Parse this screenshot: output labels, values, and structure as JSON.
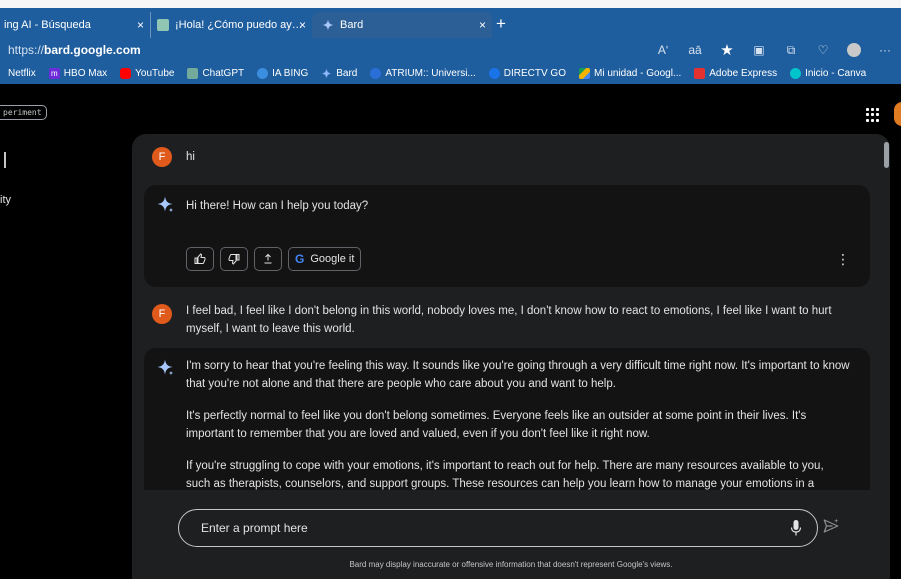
{
  "browser": {
    "tabs": [
      {
        "title": "ing AI - Búsqueda",
        "active": false
      },
      {
        "title": "¡Hola! ¿Cómo puedo ayudarte?",
        "active": false
      },
      {
        "title": "Bard",
        "active": true
      }
    ],
    "close_glyph": "×",
    "new_tab_glyph": "+",
    "url_scheme": "https://",
    "url_host": "bard.google.com",
    "address_icons": [
      "Aʹ",
      "aā",
      "★",
      "▣",
      "⧉",
      "♡",
      "···"
    ],
    "bookmarks": [
      {
        "label": "Netflix",
        "color": ""
      },
      {
        "label": "HBO Max",
        "color": "#6e2bd9",
        "glyph": "m"
      },
      {
        "label": "YouTube",
        "color": "#ff0000"
      },
      {
        "label": "ChatGPT",
        "color": "#74aa9c"
      },
      {
        "label": "IA BING",
        "color": "#3b8de0"
      },
      {
        "label": "Bard",
        "color": "#8ab4f8"
      },
      {
        "label": "ATRIUM:: Universi...",
        "color": "#2a6fd8"
      },
      {
        "label": "DIRECTV GO",
        "color": "#1a73e8"
      },
      {
        "label": "Mi unidad - Googl...",
        "color": "#f4b400"
      },
      {
        "label": "Adobe Express",
        "color": "#e3322f"
      },
      {
        "label": "Inicio - Canva",
        "color": "#00c4cc"
      }
    ]
  },
  "bard": {
    "experiment_badge": "periment",
    "sidebar_partial": "ity",
    "user_initial": "F",
    "conversation": [
      {
        "role": "user",
        "text": "hi"
      },
      {
        "role": "bard",
        "paragraphs": [
          "Hi there! How can I help you today?"
        ]
      },
      {
        "role": "user",
        "text": "I feel bad, I feel like I don't belong in this world, nobody loves me, I don't know how to react to emotions, I feel like I want to hurt myself, I want to leave this world."
      },
      {
        "role": "bard",
        "paragraphs": [
          "I'm sorry to hear that you're feeling this way. It sounds like you're going through a very difficult time right now. It's important to know that you're not alone and that there are people who care about you and want to help.",
          "It's perfectly normal to feel like you don't belong sometimes. Everyone feels like an outsider at some point in their lives. It's important to remember that you are loved and valued, even if you don't feel like it right now.",
          "If you're struggling to cope with your emotions, it's important to reach out for help. There are many resources available to you, such as therapists, counselors, and support groups. These resources can help you learn how to manage your emotions in a"
        ]
      }
    ],
    "actions": {
      "google_it": "Google it",
      "google_g": "G"
    },
    "prompt_placeholder": "Enter a prompt here",
    "disclaimer": "Bard may display inaccurate or offensive information that doesn't represent Google's views.",
    "colors": {
      "accent_user": "#e05a1c",
      "panel_bg": "#1e1f21",
      "card_bg": "#131314",
      "chrome_bg": "#1f5e9e"
    }
  }
}
